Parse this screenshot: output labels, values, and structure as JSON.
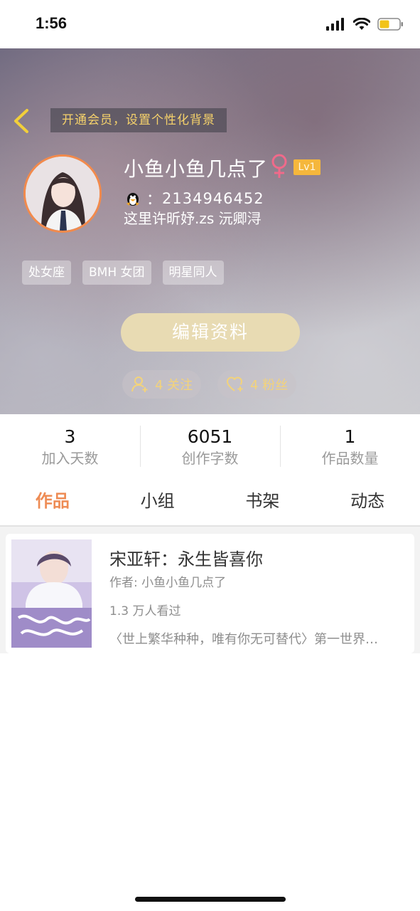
{
  "status_bar": {
    "time": "1:56",
    "icons": [
      "signal-icon",
      "wifi-icon",
      "battery-icon"
    ]
  },
  "header": {
    "vip_banner": "开通会员，设置个性化背景",
    "nickname": "小鱼小鱼几点了",
    "level": "Lv1",
    "qq_prefix": "：",
    "qq_number": "2134946452",
    "bio": "这里许昕妤.zs 沅卿浔",
    "tags": [
      "处女座",
      "BMH 女团",
      "明星同人"
    ],
    "edit_button": "编辑资料",
    "follow": "4 关注",
    "fans": "4 粉丝"
  },
  "stats": [
    {
      "value": "3",
      "label": "加入天数"
    },
    {
      "value": "6051",
      "label": "创作字数"
    },
    {
      "value": "1",
      "label": "作品数量"
    }
  ],
  "tabs": [
    "作品",
    "小组",
    "书架",
    "动态"
  ],
  "books": [
    {
      "title": "宋亚轩：永生皆喜你",
      "author": "作者: 小鱼小鱼几点了",
      "views": "1.3 万人看过",
      "summary": "〈世上繁华种种，唯有你无可替代〉第一世界…"
    }
  ],
  "colors": {
    "accent": "#ee8c55",
    "banner_text": "#f6d26b",
    "level_badge": "#f5b73c",
    "avatar_ring": "#f28a4c"
  }
}
